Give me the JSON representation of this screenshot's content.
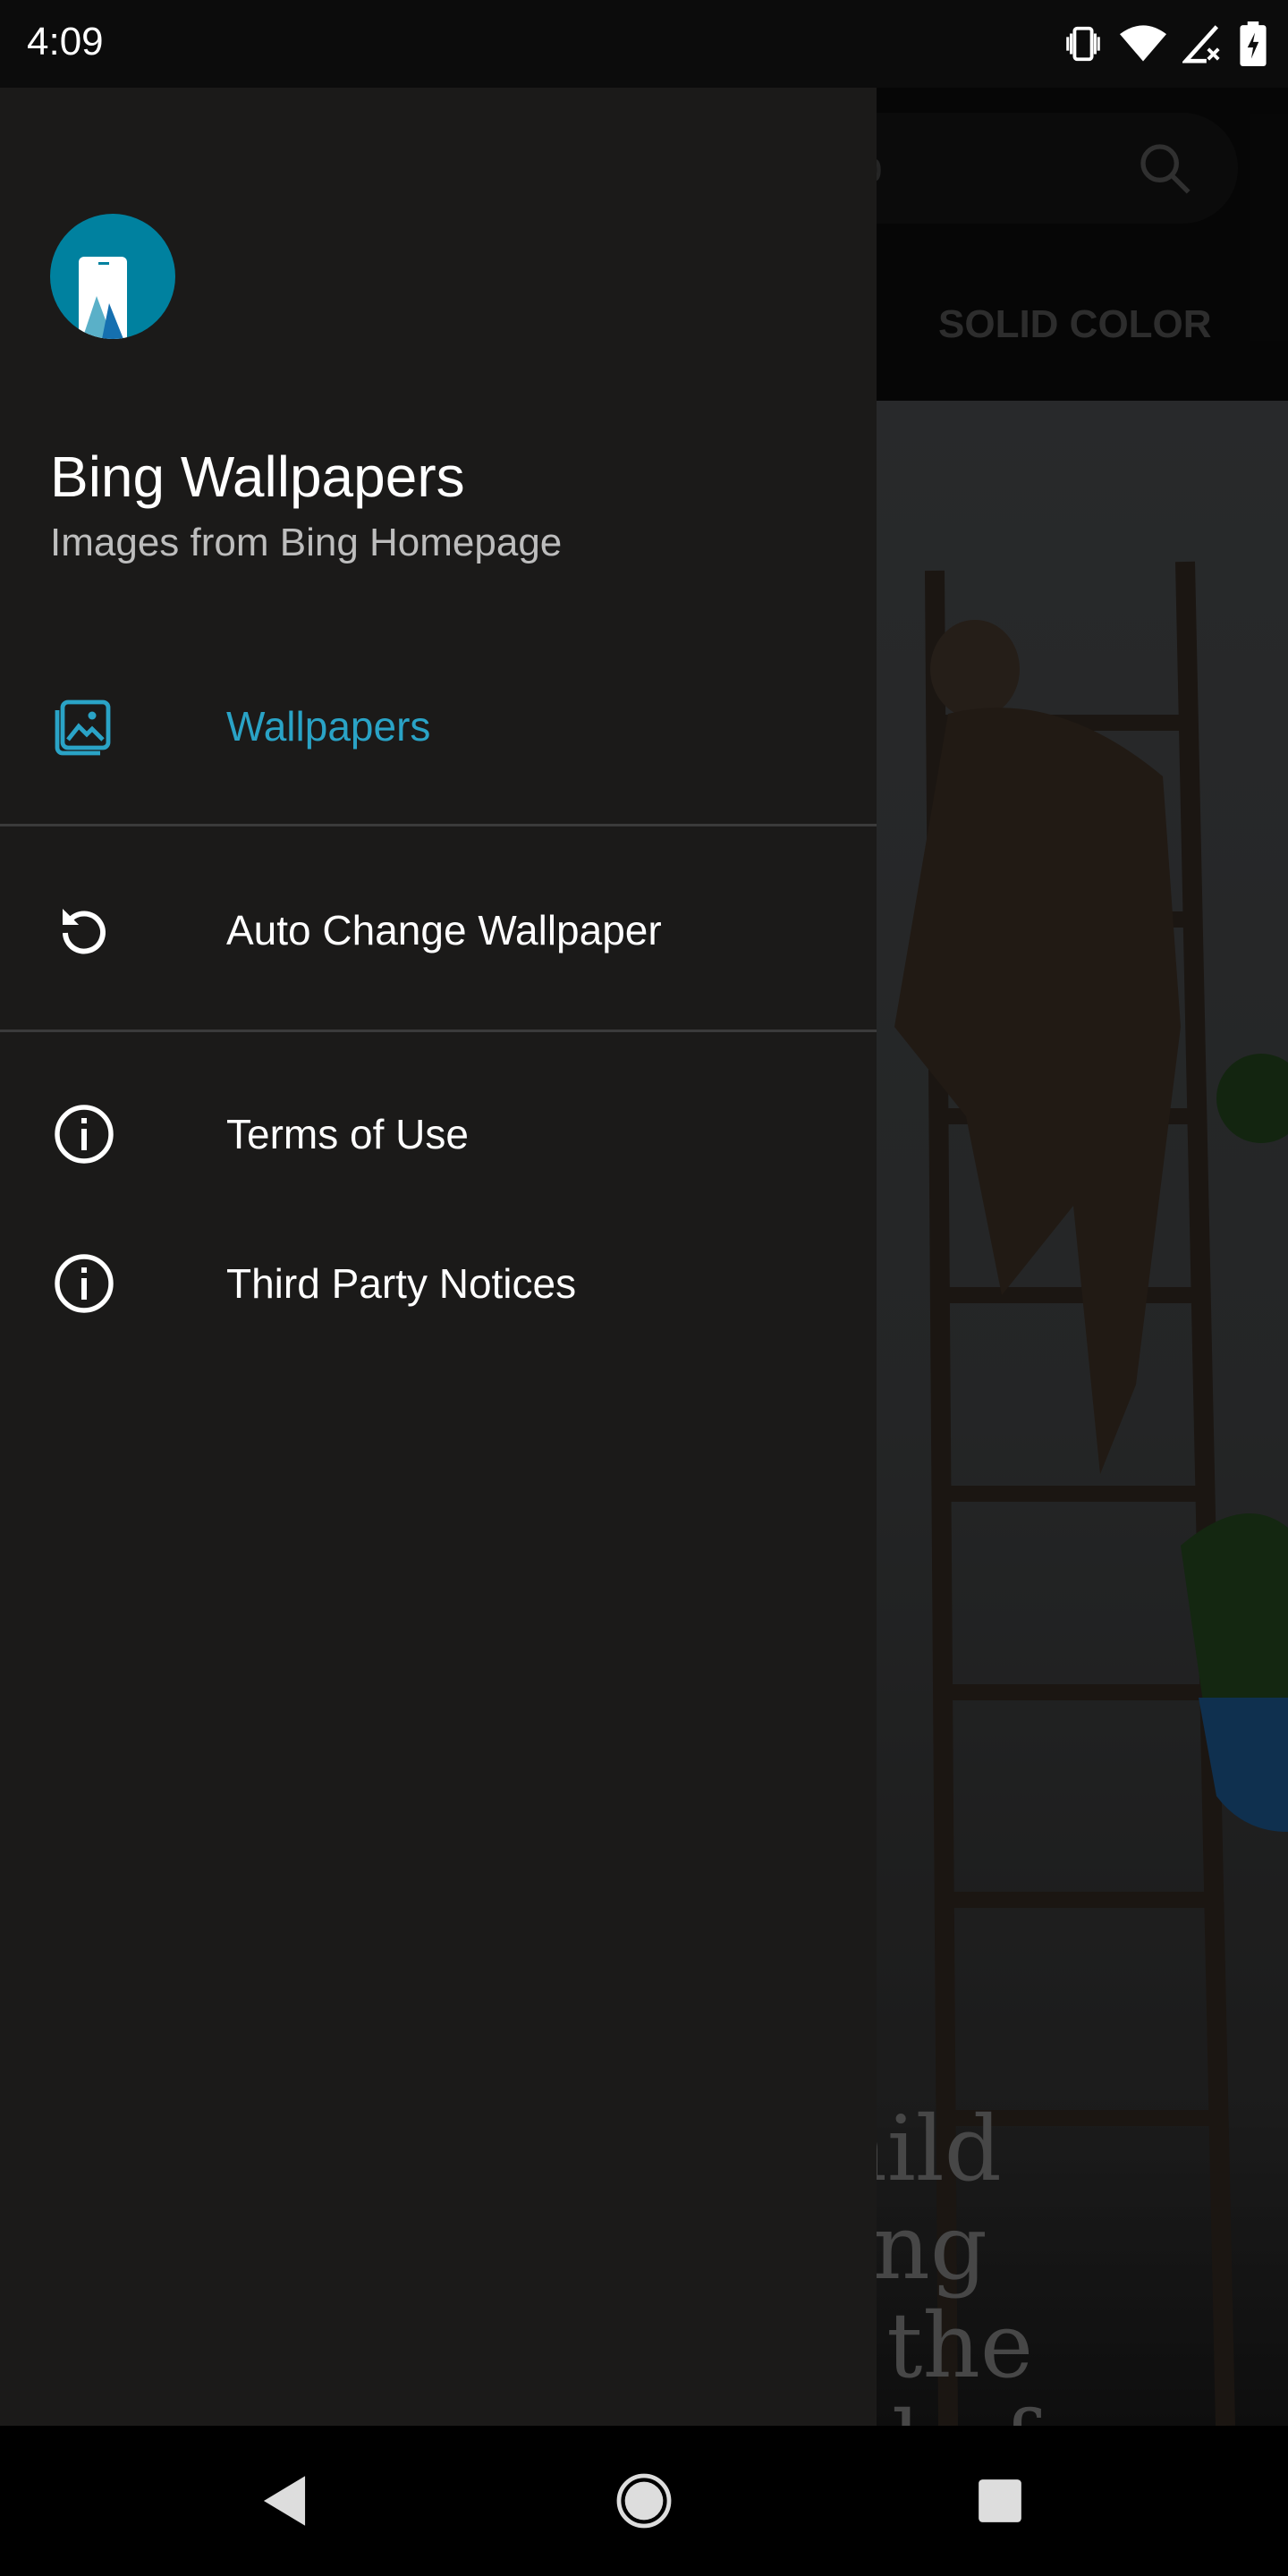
{
  "status_bar": {
    "time": "4:09",
    "icons": [
      "vibrate-icon",
      "wifi-icon",
      "signal-no-data-icon",
      "battery-charging-icon"
    ]
  },
  "background_app": {
    "search_placeholder": "b",
    "tab_label": "SOLID COLOR",
    "quote_lines": "a child\ncaring\ns in the\nhood of"
  },
  "drawer": {
    "app_title": "Bing Wallpapers",
    "app_subtitle": "Images from Bing Homepage",
    "accent_color": "#2aa3c6",
    "items": [
      {
        "label": "Wallpapers",
        "icon": "image-icon",
        "active": true
      },
      {
        "label": "Auto Change Wallpaper",
        "icon": "refresh-icon"
      },
      {
        "label": "Terms of Use",
        "icon": "info-icon"
      },
      {
        "label": "Third Party Notices",
        "icon": "info-icon"
      }
    ]
  },
  "nav_bar": {
    "buttons": [
      "back-icon",
      "home-icon",
      "recents-icon"
    ]
  }
}
